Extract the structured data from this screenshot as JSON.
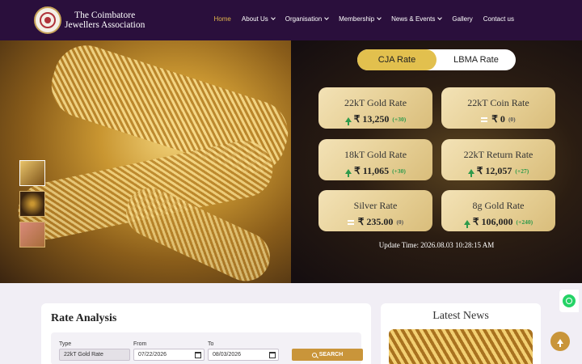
{
  "brand": {
    "line1": "The Coimbatore",
    "line2": "Jewellers Association"
  },
  "nav": [
    {
      "label": "Home",
      "active": true,
      "dropdown": false
    },
    {
      "label": "About Us",
      "active": false,
      "dropdown": true
    },
    {
      "label": "Organisation",
      "active": false,
      "dropdown": true
    },
    {
      "label": "Membership",
      "active": false,
      "dropdown": true
    },
    {
      "label": "News & Events",
      "active": false,
      "dropdown": true
    },
    {
      "label": "Gallery",
      "active": false,
      "dropdown": false
    },
    {
      "label": "Contact us",
      "active": false,
      "dropdown": false
    }
  ],
  "rate_toggle": {
    "cja": "CJA Rate",
    "lbma": "LBMA Rate",
    "selected": "cja"
  },
  "rates": [
    {
      "label": "22kT Gold Rate",
      "value": "₹ 13,250",
      "change": "(+30)",
      "trend": "up"
    },
    {
      "label": "22kT Coin Rate",
      "value": "₹ 0",
      "change": "(0)",
      "trend": "flat"
    },
    {
      "label": "18kT Gold Rate",
      "value": "₹ 11,065",
      "change": "(+30)",
      "trend": "up"
    },
    {
      "label": "22kT Return Rate",
      "value": "₹ 12,057",
      "change": "(+27)",
      "trend": "up"
    },
    {
      "label": "Silver Rate",
      "value": "₹ 235.00",
      "change": "(0)",
      "trend": "flat"
    },
    {
      "label": "8g Gold Rate",
      "value": "₹ 106,000",
      "change": "(+240)",
      "trend": "up"
    }
  ],
  "update_time": "Update Time: 2026.08.03 10:28:15 AM",
  "rate_analysis": {
    "title": "Rate Analysis",
    "type_label": "Type",
    "type_value": "22kT Gold Rate",
    "from_label": "From",
    "from_value": "07/22/2026",
    "to_label": "To",
    "to_value": "08/03/2026",
    "search_label": "SEARCH"
  },
  "latest_news": {
    "title": "Latest News"
  },
  "colors": {
    "header_bg": "#2a0f3c",
    "accent_gold": "#e2b64c",
    "button_gold": "#c9953a",
    "up_green": "#2e9a4b"
  }
}
